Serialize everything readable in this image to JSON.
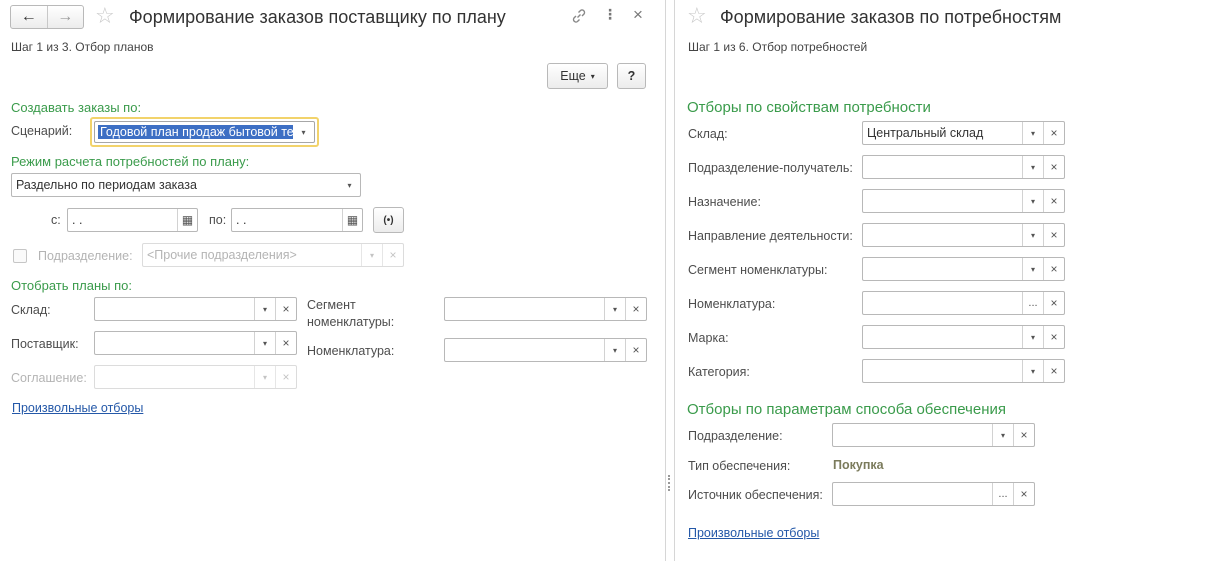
{
  "left": {
    "nav": {
      "back": "←",
      "forward": "→"
    },
    "title": "Формирование заказов поставщику по плану",
    "step": "Шаг 1 из 3. Отбор планов",
    "more_button": "Еще",
    "help_button": "?",
    "create_orders_section": "Создавать заказы по:",
    "scenario_label": "Сценарий:",
    "scenario_value": "Годовой план продаж бытовой те",
    "mode_section": "Режим расчета потребностей по плану:",
    "mode_value": "Раздельно по периодам заказа",
    "from_label": "с:",
    "from_value": " .  .",
    "to_label": "по:",
    "to_value": " .  .",
    "period_icon": "(•)",
    "subdivision_label": "Подразделение:",
    "subdivision_placeholder": "<Прочие подразделения>",
    "filter_section": "Отобрать планы по:",
    "warehouse_label": "Склад:",
    "supplier_label": "Поставщик:",
    "agreement_label": "Соглашение:",
    "segment_label_1": "Сегмент",
    "segment_label_2": "номенклатуры:",
    "nomenclature_label": "Номенклатура:",
    "custom_filters": "Произвольные отборы"
  },
  "right": {
    "title": "Формирование заказов по потребностям",
    "step": "Шаг 1 из 6. Отбор потребностей",
    "section_props": "Отборы по свойствам потребности",
    "fields": [
      {
        "label": "Склад:",
        "value": "Центральный склад",
        "btn": "▾"
      },
      {
        "label": "Подразделение-получатель:",
        "value": "",
        "btn": "▾"
      },
      {
        "label": "Назначение:",
        "value": "",
        "btn": "▾"
      },
      {
        "label": "Направление деятельности:",
        "value": "",
        "btn": "▾"
      },
      {
        "label": "Сегмент номенклатуры:",
        "value": "",
        "btn": "▾"
      },
      {
        "label": "Номенклатура:",
        "value": "",
        "btn": "..."
      },
      {
        "label": "Марка:",
        "value": "",
        "btn": "▾"
      },
      {
        "label": "Категория:",
        "value": "",
        "btn": "▾"
      }
    ],
    "section_supply": "Отборы по параметрам способа обеспечения",
    "subdivision_label": "Подразделение:",
    "supply_type_label": "Тип обеспечения:",
    "supply_type_value": "Покупка",
    "supply_source_label": "Источник обеспечения:",
    "custom_filters": "Произвольные отборы"
  },
  "icons": {
    "dropdown": "▾",
    "clear": "×",
    "calendar": "▦",
    "select": "..."
  }
}
